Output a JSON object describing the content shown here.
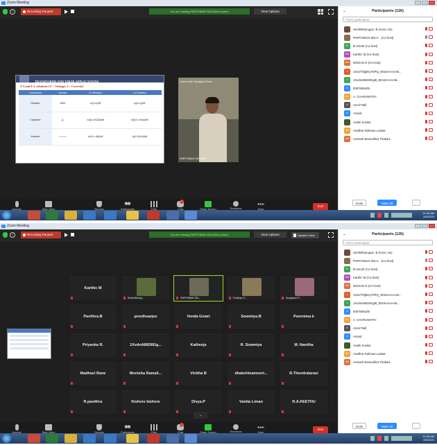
{
  "shots": [
    {
      "window_title": "Zoom Meeting",
      "recording_label": "Recording Paused",
      "banner": "You are viewing PARTHIBAN SELVAM's screen",
      "view_options": "View Options",
      "spotlight_label": "Cancel the Spotlight Video",
      "speaker_name": "PARTHIBAN SELVAM",
      "slide": {
        "title": "TRANSFORMS AND THEIR APPLICATIONS",
        "subtitle": "V-I and I-V relations (V = Voltage; I = Current)",
        "headers": [
          "Component",
          "Symbol",
          "V-I Relation",
          "I-V Relation"
        ],
        "rows": [
          [
            "Resistor",
            "-WW-",
            "vᵣ(t)=iᵣ(t)R",
            "iᵣ(t)=vᵣ(t)/R"
          ],
          [
            "Capacitor",
            "-||-",
            "vc(t)=1/C∫ic(t)dt",
            "ic(t)=C dvc(t)/dt"
          ],
          [
            "Inductor",
            "-∿∿∿-",
            "vₗ(t)=L diₗ(t)/dt",
            "iₗ(t)=1/L∫vₗ(t)dt"
          ]
        ]
      }
    },
    {
      "window_title": "Zoom Meeting",
      "recording_label": "Recording Paused",
      "banner": "You are viewing PARTHIBAN SELVAM's screen",
      "view_options": "View Options",
      "speaker_view": "Speaker View",
      "tiles_top": [
        "Karthic M",
        "SenthilMurug...",
        "PARTHIBAN SEL...",
        "Pradhap R...",
        "Durgasree P..."
      ],
      "tiles": [
        "Pavithra.B",
        "preethuarjee",
        "Venda Gowri",
        "Sowmiya.B",
        "Poornima k",
        "Priyanka R.",
        "1XvdnA86D8Gg...",
        "Katheeja",
        "R. Sowmiya",
        "M. Navitha",
        "Madhavi Rane",
        "Monisha Ramali...",
        "Vinitha B",
        "dhakshinamoort...",
        "R.Thendralarasi",
        "R.pavithra",
        "Kishore kishore",
        "Divya.P",
        "Vanita Liman",
        "R.A.KEETHU"
      ]
    }
  ],
  "toolbar": {
    "unmute": "Unmute",
    "start_video": "Start Video",
    "security": "Security",
    "participants": "Participants",
    "participant_count": "126",
    "polls": "Polls",
    "chat": "Chat",
    "share_screen": "Share Screen",
    "reactions": "Reactions",
    "more": "More",
    "end": "End"
  },
  "panel": {
    "title": "Participants (126)",
    "search_placeholder": "Find a participant",
    "invite": "Invite",
    "mute_all": "Mute All",
    "more": "...",
    "participants": [
      {
        "name": "SenthilMurugan. B (Host, me)",
        "avatar": "photo",
        "color": "#6b4a3a"
      },
      {
        "name": "PARTHIBAN SELV... (Co-host)",
        "avatar": "photo",
        "color": "#8a6a4a"
      },
      {
        "name": "B.Vinoth (Co-host)",
        "avatar": "B",
        "color": "#3aa757"
      },
      {
        "name": "Karthic M (Co-host)",
        "avatar": "KM",
        "color": "#b04fb4"
      },
      {
        "name": "MOGAN D (Co-host)",
        "avatar": "MD",
        "color": "#e0703a"
      },
      {
        "name": "1XaVTrfgbKyYbPQ_9015AAAAAB...",
        "avatar": "1",
        "color": "#e25a2b"
      },
      {
        "name": "1Xvdn486D8Gg9t_9015AAAAAB...",
        "avatar": "1",
        "color": "#3aa757"
      },
      {
        "name": "8357666429",
        "avatar": "8",
        "color": "#2d8cff"
      },
      {
        "name": "A. CHARUMATHI",
        "avatar": "AC",
        "color": "#f2a33a"
      },
      {
        "name": "Amol Patil",
        "avatar": "A",
        "color": "#555"
      },
      {
        "name": "Anand",
        "avatar": "A",
        "color": "#2d8cff"
      },
      {
        "name": "Arathi Sonika",
        "avatar": "photo",
        "color": "#3a5a2a"
      },
      {
        "name": "Aradhar Rahman Laskar",
        "avatar": "AR",
        "color": "#f2a33a"
      },
      {
        "name": "Avinash Bansodhar Thakare",
        "avatar": "AB",
        "color": "#e0703a"
      }
    ]
  },
  "clock": {
    "time": "11:46 AM",
    "date": "8/5/2020"
  }
}
